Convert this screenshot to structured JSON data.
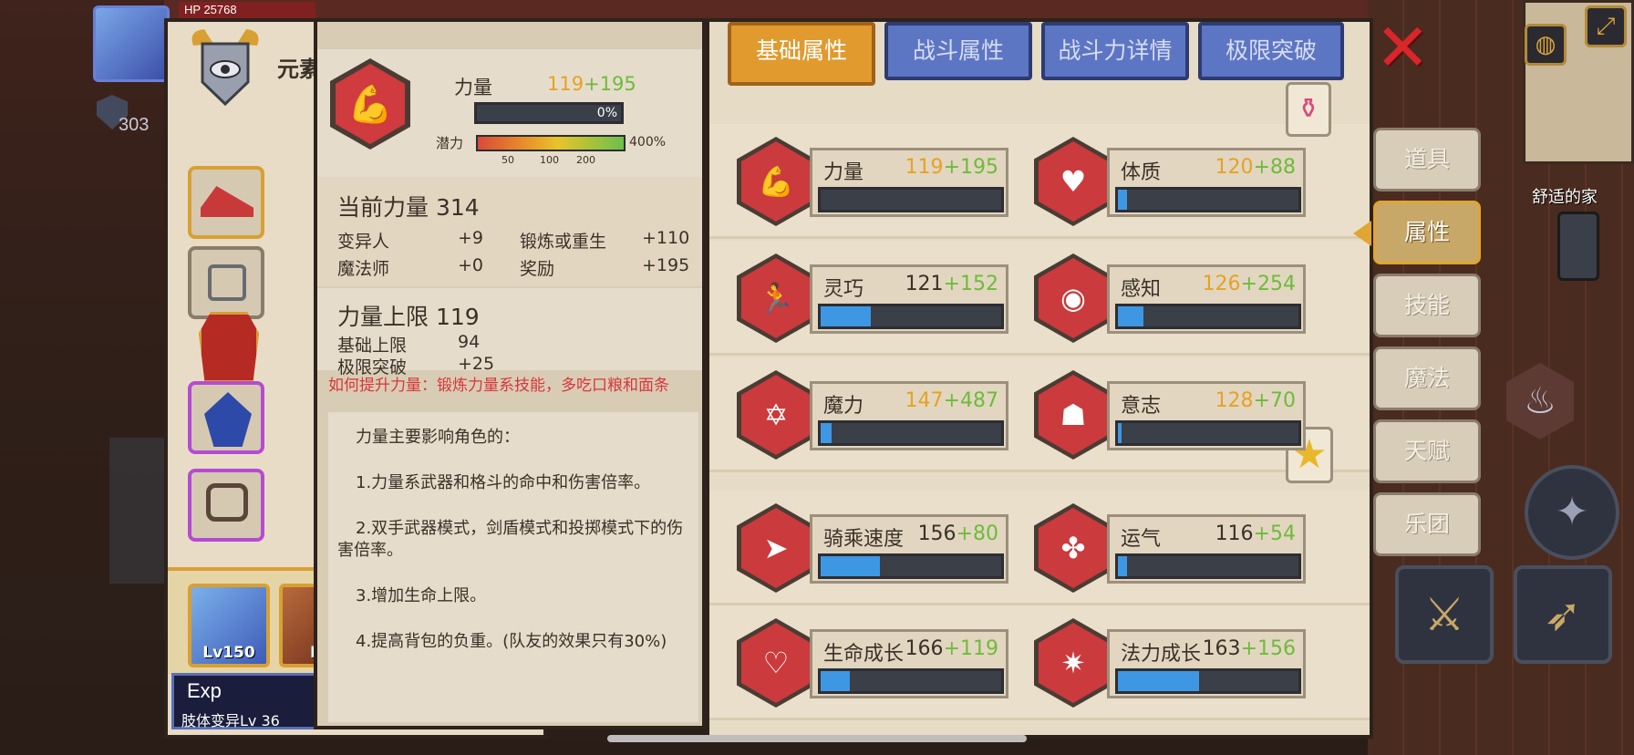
{
  "hud": {
    "hp_label": "HP",
    "hp_value": "25768",
    "shield_value": "303"
  },
  "character": {
    "name": "元素",
    "party_level": "Lv150",
    "party_level_2": "Lv",
    "exp_label": "Exp",
    "mutation": "肢体变异Lv 36"
  },
  "detail": {
    "stat_name": "力量",
    "stat_base": "119",
    "stat_bonus": "+195",
    "progress_text": "0%",
    "progress": 0,
    "potential_label": "潜力",
    "potential_max": "400%",
    "potential_ticks": [
      "50",
      "100",
      "200"
    ],
    "current_title": "当前力量 314",
    "current_rows": [
      {
        "label": "变异人",
        "value": "+9",
        "label2": "锻炼或重生",
        "value2": "+110"
      },
      {
        "label": "魔法师",
        "value": "+0",
        "label2": "奖励",
        "value2": "+195"
      }
    ],
    "limit_title": "力量上限 119",
    "limit_rows": [
      {
        "label": "基础上限",
        "value": "94"
      },
      {
        "label": "极限突破",
        "value": "+25"
      }
    ],
    "how_to": "如何提升力量：锻炼力量系技能，多吃口粮和面条",
    "desc_lines": [
      "力量主要影响角色的：",
      "1.力量系武器和格斗的命中和伤害倍率。",
      "2.双手武器模式，剑盾模式和投掷模式下的伤害倍率。",
      "3.增加生命上限。",
      "4.提高背包的负重。(队友的效果只有30%)"
    ]
  },
  "tabs": [
    {
      "label": "基础属性",
      "active": true
    },
    {
      "label": "战斗属性",
      "active": false
    },
    {
      "label": "战斗力详情",
      "active": false
    },
    {
      "label": "极限突破",
      "active": false
    }
  ],
  "attributes": [
    {
      "name": "力量",
      "base": "119",
      "bonus": "+195",
      "base_color": "#e5a224",
      "fill": 0.0,
      "icon": "muscle-icon"
    },
    {
      "name": "体质",
      "base": "120",
      "bonus": "+88",
      "base_color": "#e5a224",
      "fill": 0.05,
      "icon": "body-icon"
    },
    {
      "name": "灵巧",
      "base": "121",
      "bonus": "+152",
      "base_color": "#3a3128",
      "fill": 0.28,
      "icon": "runner-icon"
    },
    {
      "name": "感知",
      "base": "126",
      "bonus": "+254",
      "base_color": "#e5a224",
      "fill": 0.14,
      "icon": "eye-icon"
    },
    {
      "name": "魔力",
      "base": "147",
      "bonus": "+487",
      "base_color": "#e5a224",
      "fill": 0.06,
      "icon": "hexagram-icon"
    },
    {
      "name": "意志",
      "base": "128",
      "bonus": "+70",
      "base_color": "#e5a224",
      "fill": 0.02,
      "icon": "will-head-icon"
    },
    {
      "name": "骑乘速度",
      "base": "156",
      "bonus": "+80",
      "base_color": "#3a3128",
      "fill": 0.33,
      "icon": "speed-icon"
    },
    {
      "name": "运气",
      "base": "116",
      "bonus": "+54",
      "base_color": "#3a3128",
      "fill": 0.05,
      "icon": "clover-icon"
    },
    {
      "name": "生命成长",
      "base": "166",
      "bonus": "+119",
      "base_color": "#3a3128",
      "fill": 0.16,
      "icon": "heart-icon"
    },
    {
      "name": "法力成长",
      "base": "163",
      "bonus": "+156",
      "base_color": "#3a3128",
      "fill": 0.45,
      "icon": "mana-star-icon"
    }
  ],
  "side_menu": [
    {
      "label": "道具",
      "active": false
    },
    {
      "label": "属性",
      "active": true
    },
    {
      "label": "技能",
      "active": false
    },
    {
      "label": "魔法",
      "active": false
    },
    {
      "label": "天赋",
      "active": false
    },
    {
      "label": "乐团",
      "active": false
    }
  ],
  "world": {
    "home_label": "舒适的家"
  },
  "colors": {
    "accent_orange": "#e09a2e",
    "tab_blue": "#5d76c4",
    "bonus_green": "#6dbb3a",
    "bar_blue": "#3e97e3",
    "warn_red": "#d8363a"
  }
}
